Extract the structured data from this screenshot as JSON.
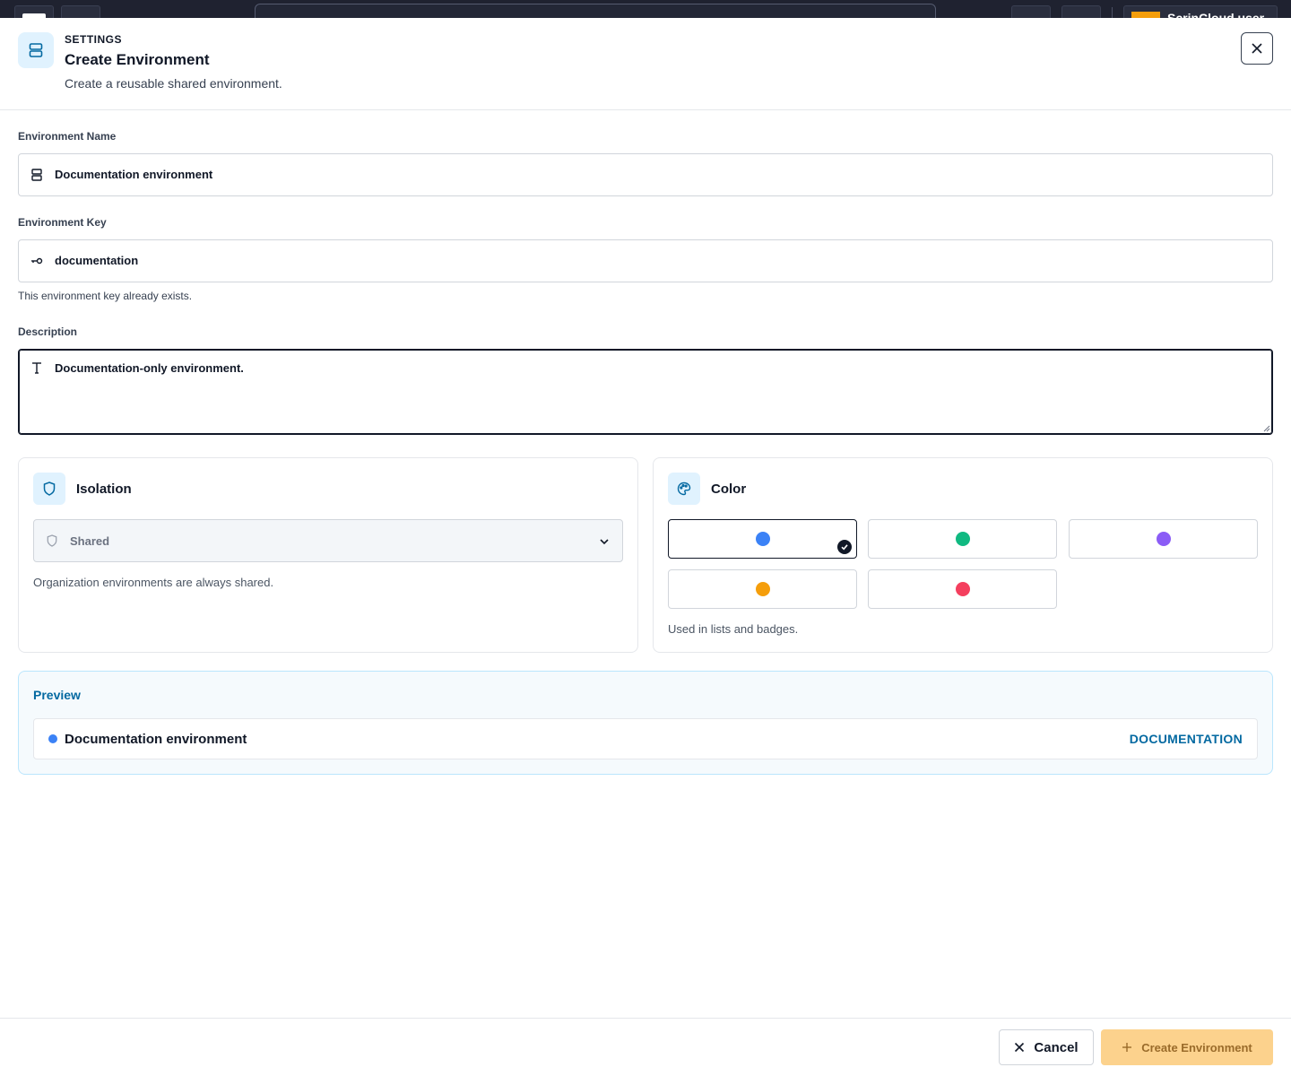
{
  "topbar": {
    "user_name": "ScrinCloud user"
  },
  "header": {
    "eyebrow": "SETTINGS",
    "title": "Create Environment",
    "subtitle": "Create a reusable shared environment."
  },
  "form": {
    "name": {
      "label": "Environment Name",
      "value": "Documentation environment"
    },
    "key": {
      "label": "Environment Key",
      "value": "documentation",
      "hint": "This environment key already exists."
    },
    "description": {
      "label": "Description",
      "value": "Documentation-only environment."
    }
  },
  "isolation": {
    "title": "Isolation",
    "selected": "Shared",
    "hint": "Organization environments are always shared."
  },
  "color": {
    "title": "Color",
    "options": [
      {
        "name": "blue",
        "hex": "#3b82f6",
        "selected": true
      },
      {
        "name": "green",
        "hex": "#10b981",
        "selected": false
      },
      {
        "name": "purple",
        "hex": "#8b5cf6",
        "selected": false
      },
      {
        "name": "orange",
        "hex": "#f59e0b",
        "selected": false
      },
      {
        "name": "red",
        "hex": "#f43f5e",
        "selected": false
      }
    ],
    "hint": "Used in lists and badges."
  },
  "preview": {
    "title": "Preview",
    "name": "Documentation environment",
    "key": "DOCUMENTATION",
    "dot_color": "#3b82f6"
  },
  "footer": {
    "cancel_label": "Cancel",
    "create_label": "Create Environment"
  },
  "colors": {
    "accent": "#0369a1",
    "create_button": "#fcd28d"
  }
}
